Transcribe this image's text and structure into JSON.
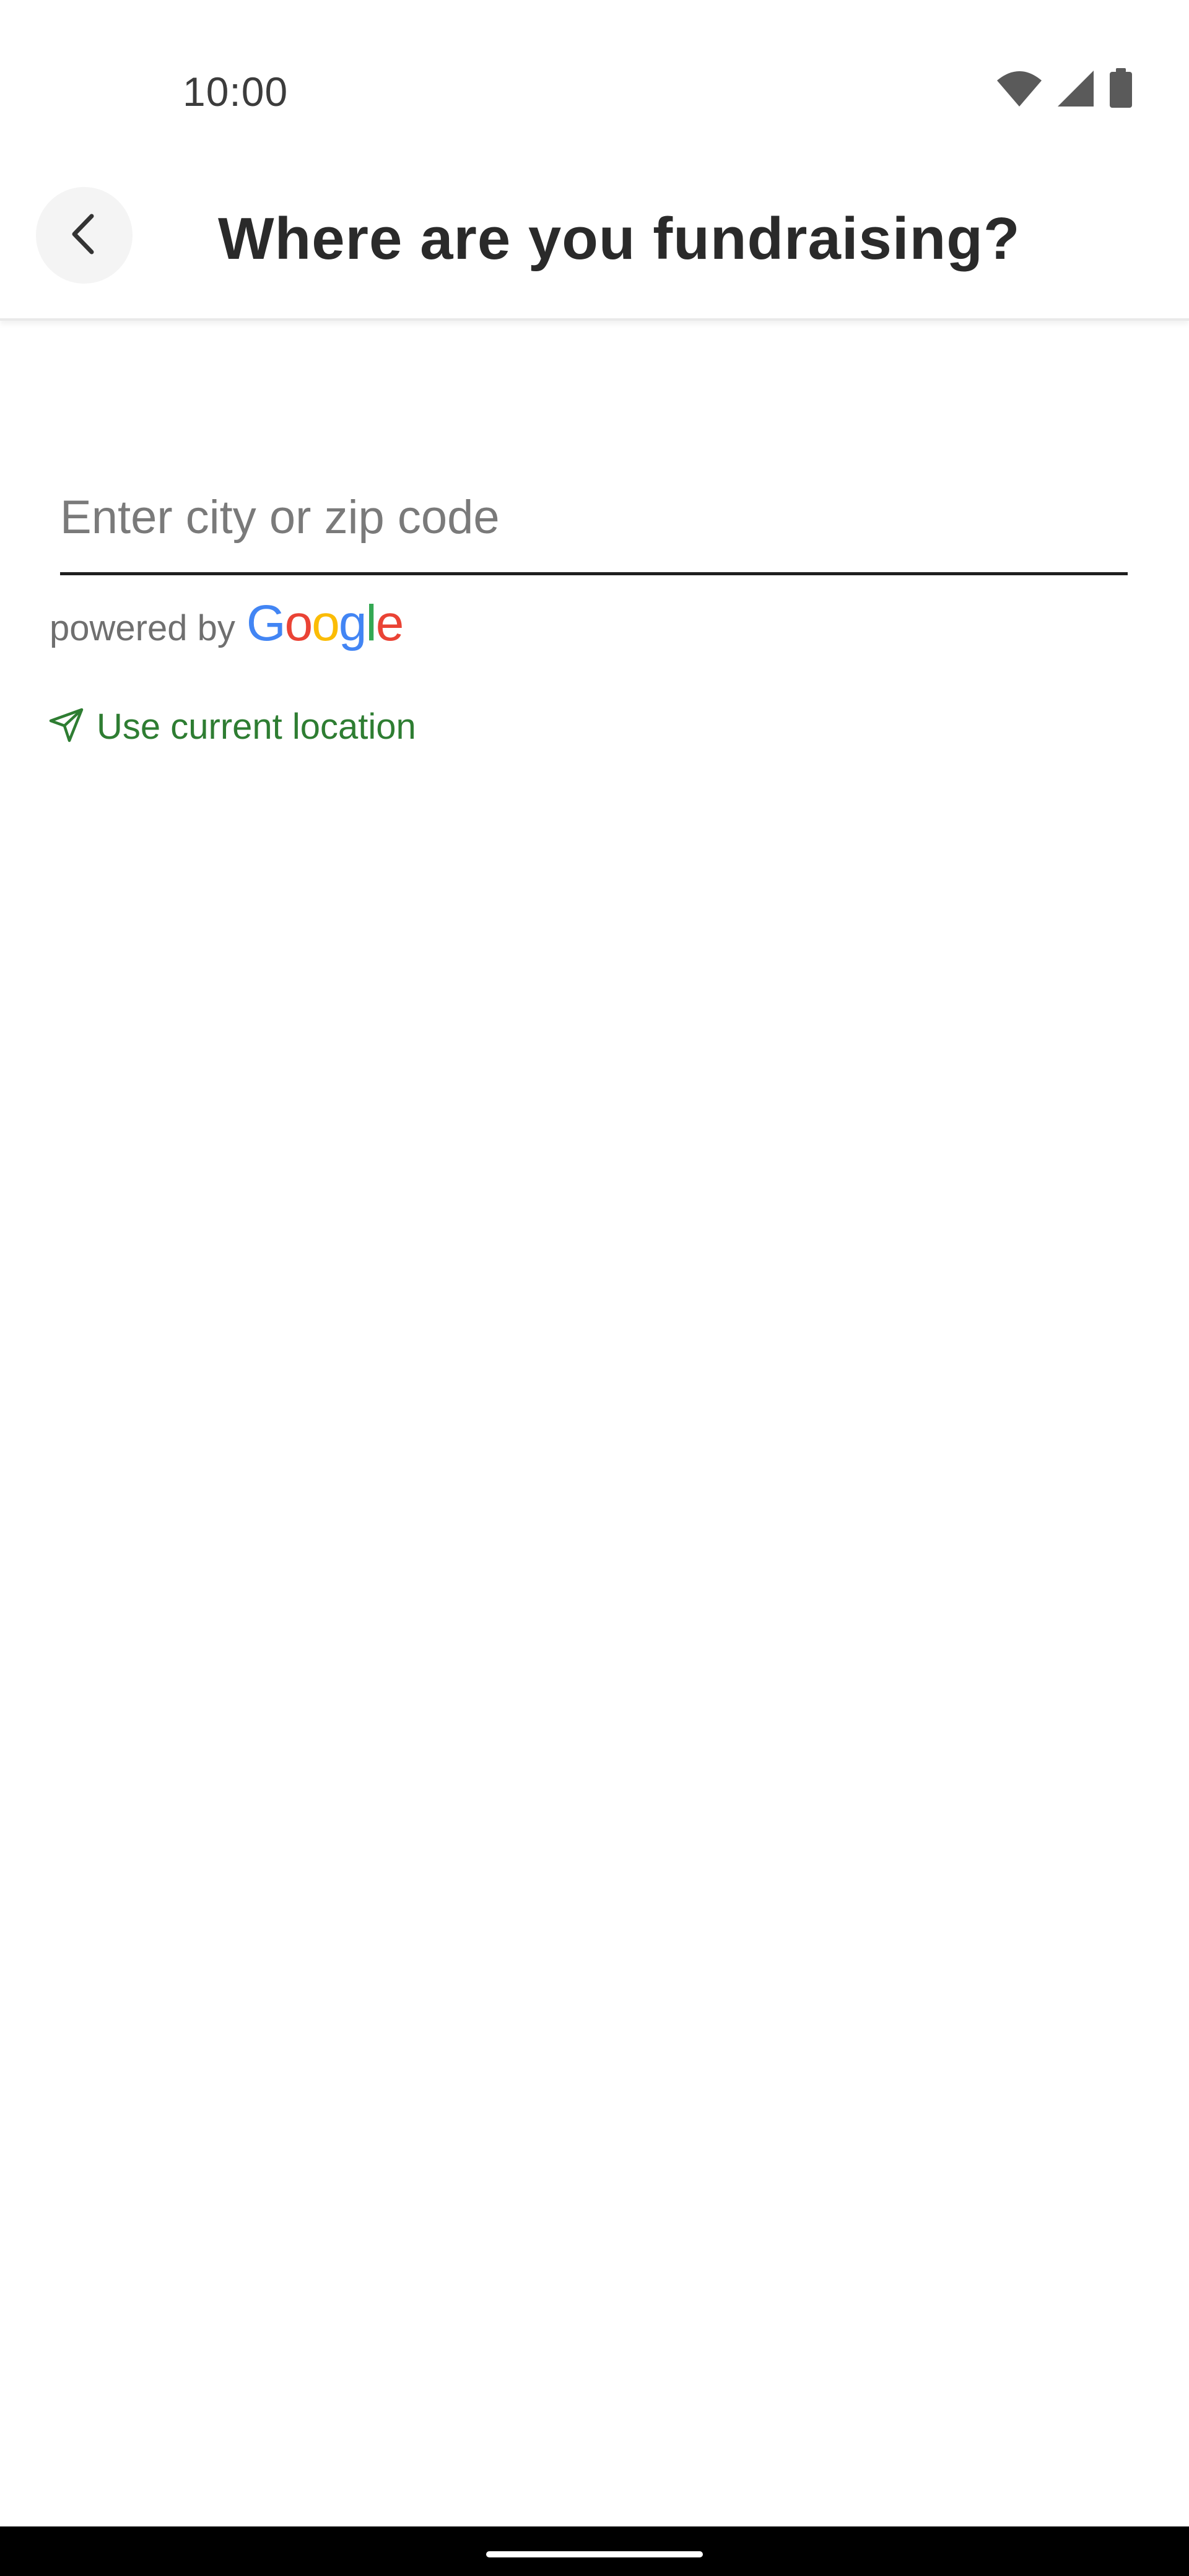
{
  "status_bar": {
    "time": "10:00",
    "icons": [
      "wifi-icon",
      "cellular-signal-icon",
      "battery-icon"
    ]
  },
  "app_bar": {
    "title": "Where are you fundraising?",
    "back_icon": "chevron-left-icon"
  },
  "search": {
    "placeholder": "Enter city or zip code",
    "value": ""
  },
  "attribution": {
    "powered_by": "powered by",
    "brand_letters": [
      "G",
      "o",
      "o",
      "g",
      "l",
      "e"
    ],
    "brand_colors": [
      "#4285F4",
      "#EA4335",
      "#FBBC05",
      "#4285F4",
      "#34A853",
      "#EA4335"
    ]
  },
  "location_action": {
    "label": "Use current location",
    "icon": "navigation-arrow-icon",
    "color": "#2e7d32"
  },
  "theme": {
    "title_color": "#2a2a2a",
    "accent": "#2e7d32",
    "underline": "#1f1f1f"
  }
}
